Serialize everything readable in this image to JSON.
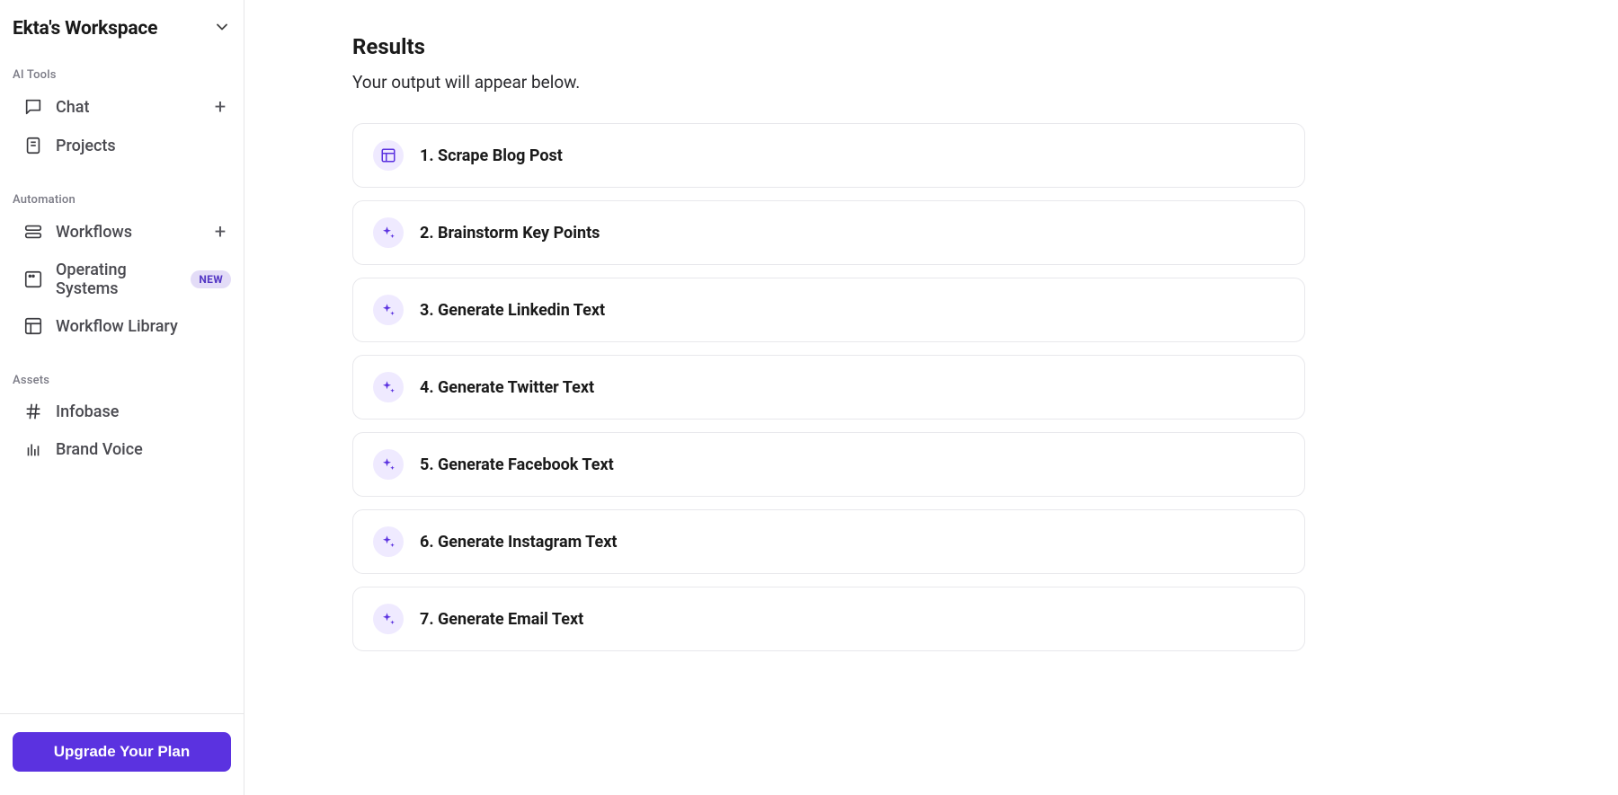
{
  "workspace": {
    "name": "Ekta's Workspace"
  },
  "sidebar": {
    "sections": [
      {
        "label": "AI Tools",
        "items": [
          {
            "label": "Chat",
            "icon": "chat",
            "has_plus": true
          },
          {
            "label": "Projects",
            "icon": "file",
            "has_plus": false
          }
        ]
      },
      {
        "label": "Automation",
        "items": [
          {
            "label": "Workflows",
            "icon": "workflows",
            "has_plus": true
          },
          {
            "label": "Operating Systems",
            "icon": "os",
            "badge": "NEW"
          },
          {
            "label": "Workflow Library",
            "icon": "library"
          }
        ]
      },
      {
        "label": "Assets",
        "items": [
          {
            "label": "Infobase",
            "icon": "hash"
          },
          {
            "label": "Brand Voice",
            "icon": "bars"
          }
        ]
      }
    ],
    "upgrade_label": "Upgrade Your Plan"
  },
  "main": {
    "title": "Results",
    "subtitle": "Your output will appear below.",
    "steps": [
      {
        "label": "1. Scrape Blog Post",
        "icon": "scrape"
      },
      {
        "label": "2. Brainstorm Key Points",
        "icon": "sparkle"
      },
      {
        "label": "3. Generate Linkedin Text",
        "icon": "sparkle"
      },
      {
        "label": "4. Generate Twitter Text",
        "icon": "sparkle"
      },
      {
        "label": "5. Generate Facebook Text",
        "icon": "sparkle"
      },
      {
        "label": "6. Generate Instagram Text",
        "icon": "sparkle"
      },
      {
        "label": "7. Generate Email Text",
        "icon": "sparkle"
      }
    ]
  }
}
